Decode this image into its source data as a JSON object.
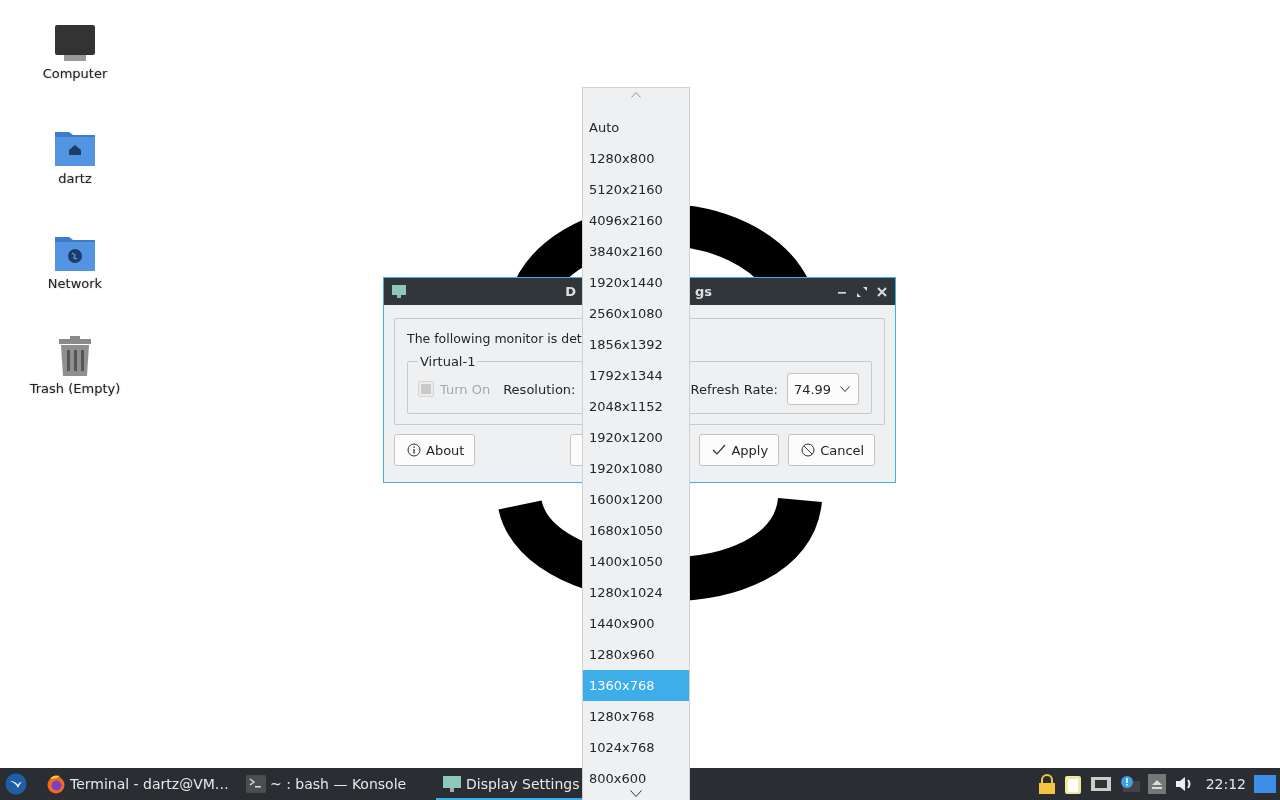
{
  "desktop_icons": [
    {
      "label": "Computer",
      "kind": "computer"
    },
    {
      "label": "dartz",
      "kind": "home"
    },
    {
      "label": "Network",
      "kind": "network"
    },
    {
      "label": "Trash (Empty)",
      "kind": "trash"
    }
  ],
  "dialog": {
    "title_parts": [
      "D",
      "gs"
    ],
    "message": "The following monitor is det",
    "group": {
      "title": "Virtual-1",
      "turn_on": {
        "label": "Turn On",
        "checked": true,
        "disabled": true
      },
      "resolution_label": "Resolution:",
      "refresh_label": "Refresh Rate:",
      "refresh_value": "74.99"
    },
    "buttons": [
      {
        "label": "About"
      },
      {
        "label": "Apply"
      },
      {
        "label": "Cancel"
      }
    ]
  },
  "dropdown": {
    "options": [
      {
        "label": "Auto",
        "selected": false
      },
      {
        "label": "1280x800",
        "selected": false
      },
      {
        "label": "5120x2160",
        "selected": false
      },
      {
        "label": "4096x2160",
        "selected": false
      },
      {
        "label": "3840x2160",
        "selected": false
      },
      {
        "label": "1920x1440",
        "selected": false
      },
      {
        "label": "2560x1080",
        "selected": false
      },
      {
        "label": "1856x1392",
        "selected": false
      },
      {
        "label": "1792x1344",
        "selected": false
      },
      {
        "label": "2048x1152",
        "selected": false
      },
      {
        "label": "1920x1200",
        "selected": false
      },
      {
        "label": "1920x1080",
        "selected": false
      },
      {
        "label": "1600x1200",
        "selected": false
      },
      {
        "label": "1680x1050",
        "selected": false
      },
      {
        "label": "1400x1050",
        "selected": false
      },
      {
        "label": "1280x1024",
        "selected": false
      },
      {
        "label": "1440x900",
        "selected": false
      },
      {
        "label": "1280x960",
        "selected": false
      },
      {
        "label": "1360x768",
        "selected": true
      },
      {
        "label": "1280x768",
        "selected": false
      },
      {
        "label": "1024x768",
        "selected": false
      },
      {
        "label": "800x600",
        "selected": false
      }
    ]
  },
  "taskbar": {
    "tasks": [
      {
        "label": "Terminal - dartz@VM…",
        "selected": false
      },
      {
        "label": "~ : bash — Konsole",
        "selected": false
      },
      {
        "label": "Display Settings",
        "selected": true
      }
    ],
    "clock": "22:12"
  }
}
